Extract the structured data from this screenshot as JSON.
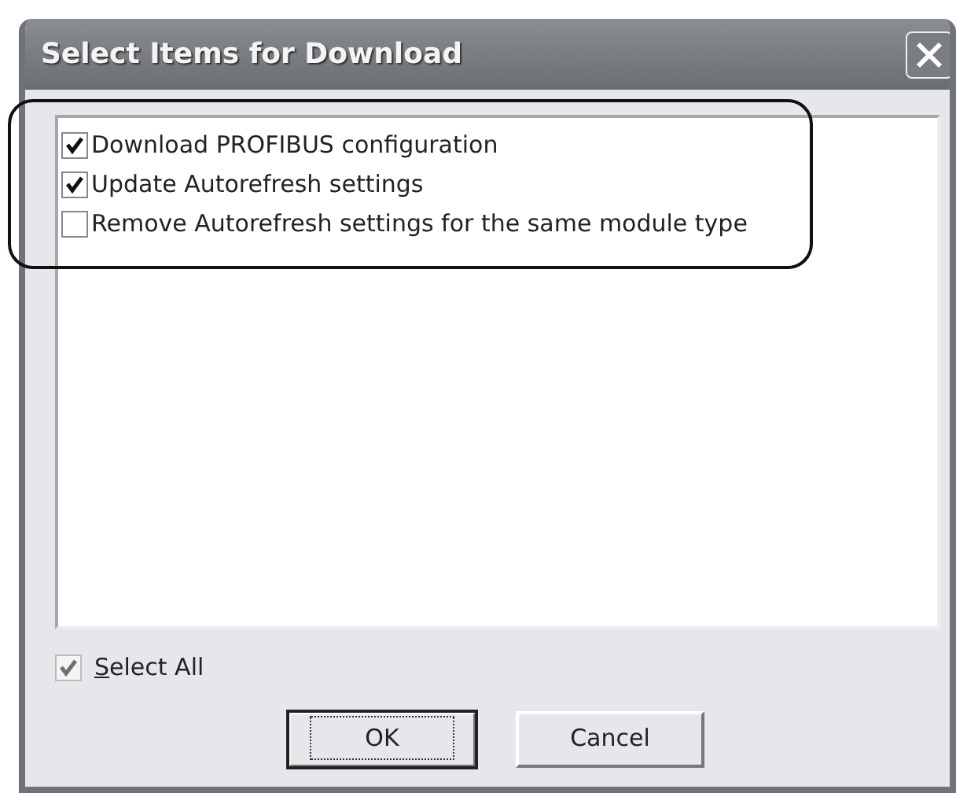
{
  "window": {
    "title": "Select Items for Download"
  },
  "items": [
    {
      "label": "Download PROFIBUS configuration",
      "checked": true
    },
    {
      "label": "Update Autorefresh settings",
      "checked": true
    },
    {
      "label": "Remove Autorefresh settings for the same module type",
      "checked": false
    }
  ],
  "select_all": {
    "label": "Select All",
    "checked": true,
    "disabled": true
  },
  "buttons": [
    {
      "label": "OK",
      "default": true
    },
    {
      "label": "Cancel",
      "default": false
    }
  ]
}
